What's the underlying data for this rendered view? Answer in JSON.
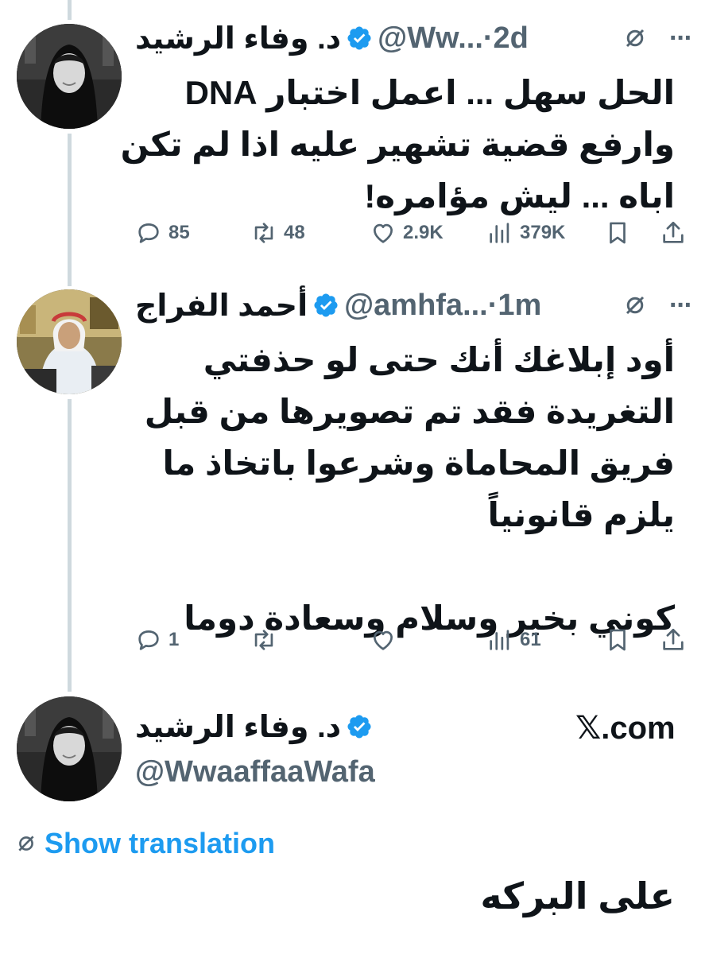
{
  "tweets": [
    {
      "name": "د. وفاء الرشيد",
      "handle_time": "@Ww...·2d",
      "text": "الحل سهل ... اعمل اختبار DNA\nوارفع قضية تشهير عليه اذا لم تكن\nاباه ... ليش مؤامره!",
      "replies": "85",
      "retweets": "48",
      "likes": "2.9K",
      "views": "379K"
    },
    {
      "name": "أحمد الفراج",
      "handle_time": "@amhfa...·1m",
      "text": "أود إبلاغك أنك حتى لو حذفتي\nالتغريدة فقد تم تصويرها من قبل\nفريق المحاماة وشرعوا باتخاذ ما\nيلزم قانونياً\n\nكوني بخير وسلام وسعادة دوما",
      "replies": "1",
      "retweets": "",
      "likes": "",
      "views": "61"
    }
  ],
  "main_post": {
    "name": "د. وفاء الرشيد",
    "handle": "@WwaaffaaWafa",
    "site": "𝕏.com",
    "show_translation": "Show translation",
    "text": "على البركه"
  },
  "icons": {
    "verified": "verified-badge-icon",
    "more": "more-dots-icon",
    "translate": "translate-icon",
    "reply": "reply-icon",
    "retweet": "retweet-icon",
    "like": "heart-icon",
    "views": "views-icon",
    "bookmark": "bookmark-icon",
    "share": "share-icon"
  },
  "colors": {
    "accent": "#1d9bf0",
    "muted": "#536471",
    "text": "#0f1419",
    "thread_line": "#cfd9de"
  }
}
